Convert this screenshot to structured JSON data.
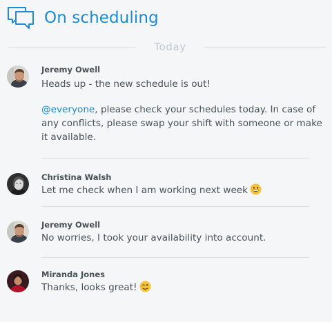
{
  "header": {
    "title": "On scheduling",
    "icon": "chat-bubbles-icon",
    "accent_color": "#1f8ad6"
  },
  "divider": {
    "label": "Today"
  },
  "messages": [
    {
      "author": "Jeremy Owell",
      "avatar": "avatar-jeremy",
      "lines": [
        "Heads up - the new schedule is out!"
      ],
      "mention": "@everyone",
      "mention_rest": ", please check your schedules today. In case of any conflicts, please swap your shift with someone or make it available."
    },
    {
      "author": "Christina Walsh",
      "avatar": "avatar-christina",
      "text": "Let me check when I am working next week",
      "emoji": "grinning-face-emoji"
    },
    {
      "author": "Jeremy Owell",
      "avatar": "avatar-jeremy",
      "text": "No worries, I took your availability into account."
    },
    {
      "author": "Miranda Jones",
      "avatar": "avatar-miranda",
      "text": "Thanks, looks great!",
      "emoji": "winking-face-emoji"
    }
  ]
}
